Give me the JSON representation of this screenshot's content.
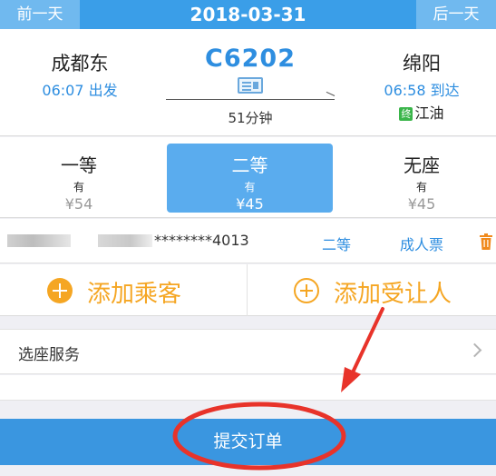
{
  "date_bar": {
    "prev_label": "前一天",
    "date": "2018-03-31",
    "next_label": "后一天"
  },
  "train": {
    "number": "C6202",
    "from_station": "成都东",
    "from_time": "06:07 出发",
    "to_station": "绵阳",
    "to_time": "06:58 到达",
    "terminal_badge": "终",
    "terminal_station": "江油",
    "duration": "51分钟"
  },
  "seats": [
    {
      "name": "一等",
      "availability": "有",
      "price": "¥54",
      "selected": false
    },
    {
      "name": "二等",
      "availability": "有",
      "price": "¥45",
      "selected": true
    },
    {
      "name": "无座",
      "availability": "有",
      "price": "¥45",
      "selected": false
    }
  ],
  "passenger": {
    "id_number": "********4013",
    "seat_class": "二等",
    "ticket_type": "成人票",
    "icon": "trash-icon"
  },
  "actions": {
    "add_passenger": "添加乘客",
    "add_beneficiary": "添加受让人"
  },
  "seat_service": {
    "label": "选座服务"
  },
  "submit": {
    "label": "提交订单"
  },
  "colors": {
    "primary_blue": "#3a9ee8",
    "accent_orange": "#f5a623",
    "annotation_red": "#e8332a"
  }
}
